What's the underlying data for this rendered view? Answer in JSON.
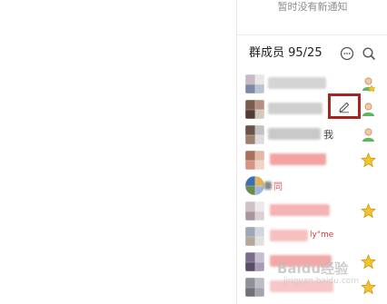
{
  "notice": "暂时没有新通知",
  "members": {
    "title": "群成员 95/25"
  },
  "snippets": {
    "row3": "我",
    "row5": "同",
    "row8": "ly\"me"
  },
  "watermark": {
    "main": "Baidu经验",
    "sub": "jingyan.baidu.com"
  },
  "colors": {
    "highlight": "#a5241f",
    "owner_star": "#f4c430",
    "member_green": "#5cb85c"
  },
  "icons": {
    "chat": "chat-bubble-icon",
    "search": "search-icon",
    "edit": "pencil-icon"
  }
}
